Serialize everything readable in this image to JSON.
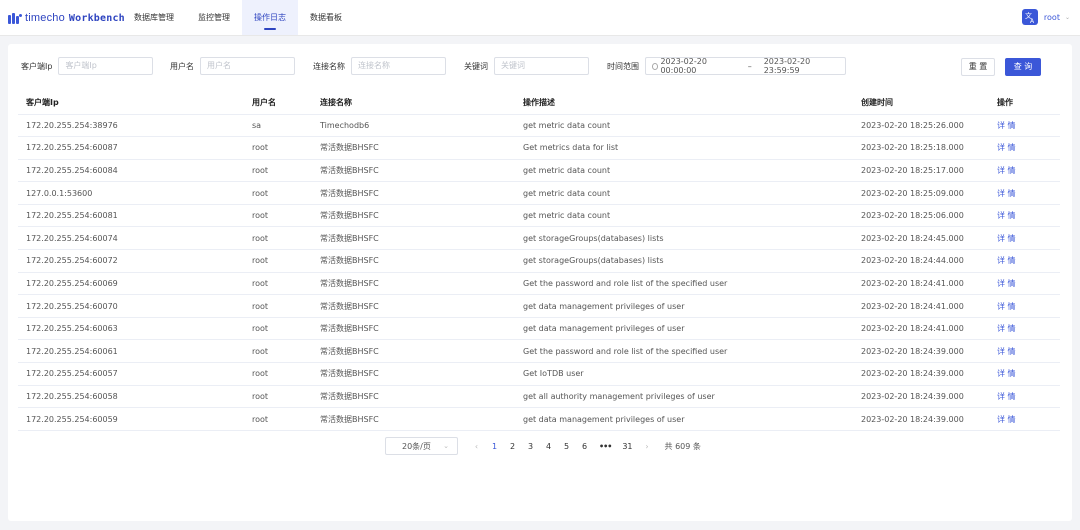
{
  "app": {
    "brand": "timecho",
    "product": "Workbench"
  },
  "nav": {
    "items": [
      {
        "label": "数据库管理"
      },
      {
        "label": "监控管理"
      },
      {
        "label": "操作日志"
      },
      {
        "label": "数据看板"
      }
    ],
    "active_index": 2
  },
  "user": {
    "avatar_icon": "translate-icon",
    "name": "root"
  },
  "filters": {
    "client_ip": {
      "label": "客户端Ip",
      "placeholder": "客户端Ip"
    },
    "username": {
      "label": "用户名",
      "placeholder": "用户名"
    },
    "connection": {
      "label": "连接名称",
      "placeholder": "连接名称"
    },
    "keyword": {
      "label": "关键词",
      "placeholder": "关键词"
    },
    "time_range": {
      "label": "时间范围",
      "start": "2023-02-20 00:00:00",
      "separator": "–",
      "end": "2023-02-20 23:59:59"
    },
    "reset_label": "重 置",
    "query_label": "查 询"
  },
  "table": {
    "columns": [
      "客户端Ip",
      "用户名",
      "连接名称",
      "操作描述",
      "创建时间",
      "操作"
    ],
    "action_label": "详 情",
    "rows": [
      {
        "ip": "172.20.255.254:38976",
        "user": "sa",
        "conn": "Timechodb6",
        "desc": "get metric data count",
        "time": "2023-02-20 18:25:26.000"
      },
      {
        "ip": "172.20.255.254:60087",
        "user": "root",
        "conn": "常活数据BHSFC",
        "desc": "Get metrics data for list",
        "time": "2023-02-20 18:25:18.000"
      },
      {
        "ip": "172.20.255.254:60084",
        "user": "root",
        "conn": "常活数据BHSFC",
        "desc": "get metric data count",
        "time": "2023-02-20 18:25:17.000"
      },
      {
        "ip": "127.0.0.1:53600",
        "user": "root",
        "conn": "常活数据BHSFC",
        "desc": "get metric data count",
        "time": "2023-02-20 18:25:09.000"
      },
      {
        "ip": "172.20.255.254:60081",
        "user": "root",
        "conn": "常活数据BHSFC",
        "desc": "get metric data count",
        "time": "2023-02-20 18:25:06.000"
      },
      {
        "ip": "172.20.255.254:60074",
        "user": "root",
        "conn": "常活数据BHSFC",
        "desc": "get storageGroups(databases) lists",
        "time": "2023-02-20 18:24:45.000"
      },
      {
        "ip": "172.20.255.254:60072",
        "user": "root",
        "conn": "常活数据BHSFC",
        "desc": "get storageGroups(databases) lists",
        "time": "2023-02-20 18:24:44.000"
      },
      {
        "ip": "172.20.255.254:60069",
        "user": "root",
        "conn": "常活数据BHSFC",
        "desc": "Get the password and role list of the specified user",
        "time": "2023-02-20 18:24:41.000"
      },
      {
        "ip": "172.20.255.254:60070",
        "user": "root",
        "conn": "常活数据BHSFC",
        "desc": "get data management privileges of user",
        "time": "2023-02-20 18:24:41.000"
      },
      {
        "ip": "172.20.255.254:60063",
        "user": "root",
        "conn": "常活数据BHSFC",
        "desc": "get data management privileges of user",
        "time": "2023-02-20 18:24:41.000"
      },
      {
        "ip": "172.20.255.254:60061",
        "user": "root",
        "conn": "常活数据BHSFC",
        "desc": "Get the password and role list of the specified user",
        "time": "2023-02-20 18:24:39.000"
      },
      {
        "ip": "172.20.255.254:60057",
        "user": "root",
        "conn": "常活数据BHSFC",
        "desc": "Get IoTDB user",
        "time": "2023-02-20 18:24:39.000"
      },
      {
        "ip": "172.20.255.254:60058",
        "user": "root",
        "conn": "常活数据BHSFC",
        "desc": "get all authority management privileges of user",
        "time": "2023-02-20 18:24:39.000"
      },
      {
        "ip": "172.20.255.254:60059",
        "user": "root",
        "conn": "常活数据BHSFC",
        "desc": "get data management privileges of user",
        "time": "2023-02-20 18:24:39.000"
      }
    ]
  },
  "pagination": {
    "page_size_label": "20条/页",
    "prev_icon": "chevron-left-icon",
    "next_icon": "chevron-right-icon",
    "pages": [
      "1",
      "2",
      "3",
      "4",
      "5",
      "6"
    ],
    "more": "•••",
    "last_page": "31",
    "current_page": "1",
    "total_label": "共 609 条"
  }
}
